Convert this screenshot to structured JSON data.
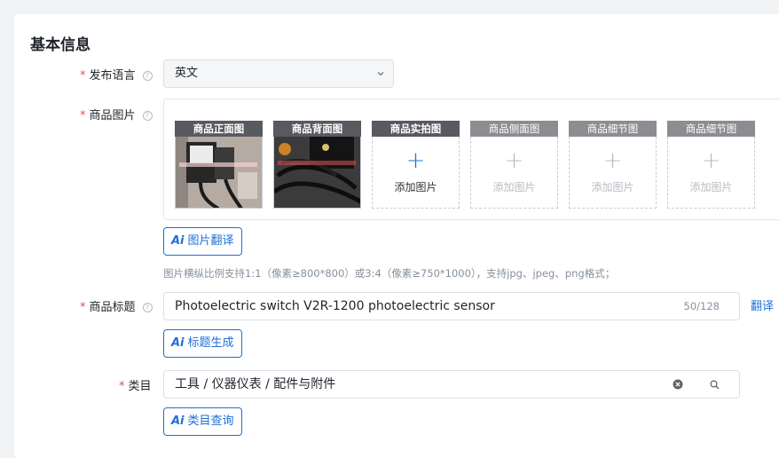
{
  "section": {
    "title": "基本信息"
  },
  "language": {
    "label": "发布语言",
    "required_mark": "*",
    "help": "?",
    "value": "英文"
  },
  "images": {
    "label": "商品图片",
    "required_mark": "*",
    "help": "?",
    "slots": [
      {
        "title": "商品正面图",
        "state": "photo"
      },
      {
        "title": "商品背面图",
        "state": "photo"
      },
      {
        "title": "商品实拍图",
        "state": "add",
        "add_label": "添加图片",
        "plus": "+"
      },
      {
        "title": "商品侧面图",
        "state": "disabled",
        "add_label": "添加图片",
        "plus": "+"
      },
      {
        "title": "商品细节图",
        "state": "disabled",
        "add_label": "添加图片",
        "plus": "+"
      },
      {
        "title": "商品细节图",
        "state": "disabled",
        "add_label": "添加图片",
        "plus": "+"
      }
    ],
    "translate_button": {
      "ai": "Ai",
      "label": "图片翻译"
    },
    "hint": "图片横纵比例支持1:1（像素≥800*800）或3:4（像素≥750*1000），支持jpg、jpeg、png格式；"
  },
  "title_field": {
    "label": "商品标题",
    "required_mark": "*",
    "help": "?",
    "value": "Photoelectric switch V2R-1200 photoelectric sensor",
    "counter": "50/128",
    "translate_link": "翻译",
    "generate_button": {
      "ai": "Ai",
      "label": "标题生成"
    }
  },
  "category": {
    "label": "类目",
    "required_mark": "*",
    "value": "工具 / 仪器仪表 / 配件与附件",
    "query_button": {
      "ai": "Ai",
      "label": "类目查询"
    }
  },
  "colors": {
    "accent": "#1f6fd6",
    "required": "#e34d59"
  }
}
